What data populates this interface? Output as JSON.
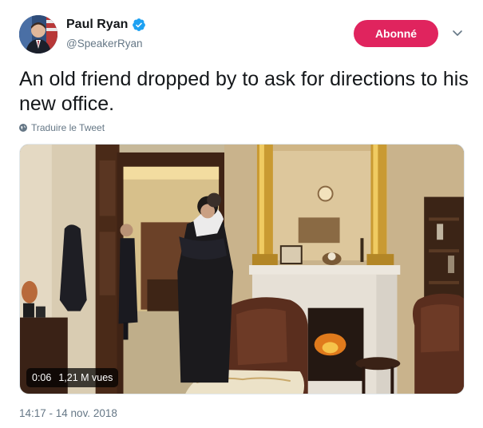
{
  "author": {
    "name": "Paul Ryan",
    "handle": "@SpeakerRyan",
    "verified_icon": "verified-badge-icon"
  },
  "follow_button": {
    "label": "Abonné",
    "color": "#e0245e"
  },
  "tweet": {
    "text": "An old friend dropped by to ask for directions to his new office.",
    "translate_label": "Traduire le Tweet",
    "timestamp": "14:17 - 14 nov. 2018"
  },
  "video": {
    "duration": "0:06",
    "views": "1,21 M vues"
  },
  "colors": {
    "accent": "#1da1f2",
    "follow": "#e0245e",
    "secondary_text": "#657786"
  }
}
